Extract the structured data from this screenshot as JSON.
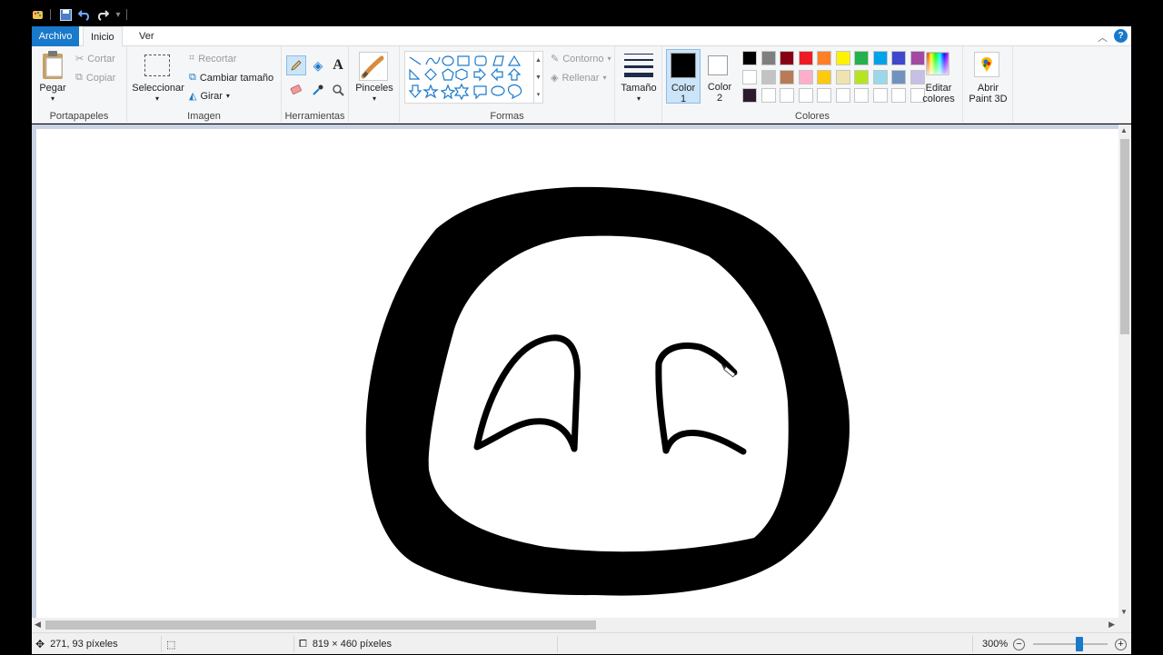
{
  "quick_access": {
    "icons": [
      "paint-app-icon",
      "save-icon",
      "undo-icon",
      "redo-icon",
      "customize-icon"
    ]
  },
  "tabs": {
    "archivo": "Archivo",
    "inicio": "Inicio",
    "ver": "Ver"
  },
  "ribbon": {
    "portapapeles": {
      "label": "Portapapeles",
      "pegar": "Pegar",
      "cortar": "Cortar",
      "copiar": "Copiar"
    },
    "imagen": {
      "label": "Imagen",
      "seleccionar": "Seleccionar",
      "recortar": "Recortar",
      "cambiar_tamano": "Cambiar tamaño",
      "girar": "Girar"
    },
    "herramientas": {
      "label": "Herramientas"
    },
    "pinceles": {
      "label": "Pinceles"
    },
    "formas": {
      "label": "Formas",
      "contorno": "Contorno",
      "rellenar": "Rellenar"
    },
    "tamano": {
      "label": "Tamaño"
    },
    "colores": {
      "label": "Colores",
      "color1_line1": "Color",
      "color1_line2": "1",
      "color1_value": "#000000",
      "color2_line1": "Color",
      "color2_line2": "2",
      "color2_value": "#ffffff",
      "editar_line1": "Editar",
      "editar_line2": "colores",
      "palette_row1": [
        "#000000",
        "#7f7f7f",
        "#880015",
        "#ed1c24",
        "#ff7f27",
        "#fff200",
        "#22b14c",
        "#00a2e8",
        "#3f48cc",
        "#a349a4"
      ],
      "palette_row2": [
        "#ffffff",
        "#c3c3c3",
        "#b97a57",
        "#ffaec9",
        "#ffc90e",
        "#efe4b0",
        "#b5e61d",
        "#99d9ea",
        "#7092be",
        "#c8bfe7"
      ],
      "palette_row3": [
        "#2c1b2e",
        "#ffffff",
        "#ffffff",
        "#ffffff",
        "#ffffff",
        "#ffffff",
        "#ffffff",
        "#ffffff",
        "#ffffff",
        "#ffffff"
      ]
    },
    "paint3d": {
      "line1": "Abrir",
      "line2": "Paint 3D"
    }
  },
  "status": {
    "cursor_pos": "271, 93 píxeles",
    "canvas_size": "819 × 460 píxeles",
    "zoom": "300%",
    "zoom_fraction": 0.62
  }
}
